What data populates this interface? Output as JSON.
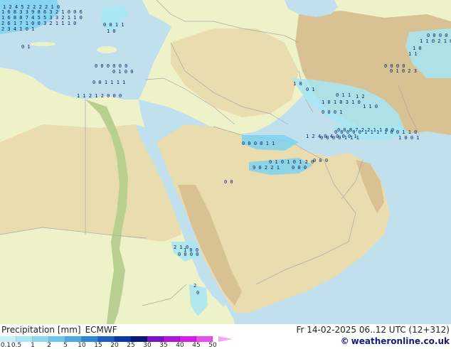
{
  "header": {
    "product": "Precipitation [mm]",
    "model": "ECMWF",
    "valid": "Fr 14-02-2025 06..12 UTC (12+312)",
    "credit": "weatheronline.co.uk",
    "copyright_symbol": "©"
  },
  "legend": {
    "ticks": [
      "0.1",
      "0.5",
      "1",
      "2",
      "5",
      "10",
      "15",
      "20",
      "25",
      "30",
      "35",
      "40",
      "45",
      "50"
    ],
    "colors": [
      "#c8f0f8",
      "#a8e8f4",
      "#8cd8f0",
      "#6cc4ec",
      "#4aa8e4",
      "#2c86d6",
      "#1a5ec4",
      "#0c38a8",
      "#06187c",
      "#7a10c8",
      "#b014dc",
      "#d21ee8",
      "#e84ef2",
      "#f4a6ff"
    ]
  },
  "map": {
    "colors": {
      "sea": "#bfe0ec",
      "land_low": "#eef2c8",
      "desert": "#e9dcae",
      "highland": "#d8c294",
      "nile": "#b8cf90",
      "precip_light": "#a6e6f5",
      "precip_mid": "#7cd2f0",
      "border": "#a8a8a8"
    },
    "precip_labels": [
      "1 2 4 5 2 2 2 2 1 0",
      "1 6 8 3 3 9 8 6 3 2 1 0 0 6",
      "1 6 8 8 7 4 5 5 3 3 2 1 1 0",
      "2 6 1 7 1 0 0 3 2 1 1 1 0",
      "2 3 4 1 0 1",
      "0 0 1 1",
      "1 0",
      "0 1",
      "0 0 0 0 0 0",
      "0 1 0 0",
      "0 0 1 1 1 1",
      "1 1 2 1 2 0 0 0",
      "0 0 0 0",
      "0 1 0 2 3",
      "1 0",
      "0 1",
      "0 1 1",
      "1 2",
      "1 0 1 0 3 1 0",
      "0 0 0 1",
      "1 1 0",
      "0 0 0 0 2",
      "1 1 0 2 1 0",
      "1 0",
      "1 1",
      "0 0 0 0 1 1",
      "0 0 0 0 0 1 1 1",
      "0 0 0 0 1 1 1",
      "0 0 8 7 2 2 1 1 0 0",
      "1 0 0 1 1 0",
      "1 0 0 1",
      "1 2 4 0 4 0 0 0 1",
      "0 1 0 1 0 1 2 0",
      "9 0 2 2 1",
      "0 0 0",
      "0 0 0",
      "0 0",
      "2 1 0",
      "0 0 0 0",
      "1 0 0",
      "2",
      "0"
    ]
  }
}
